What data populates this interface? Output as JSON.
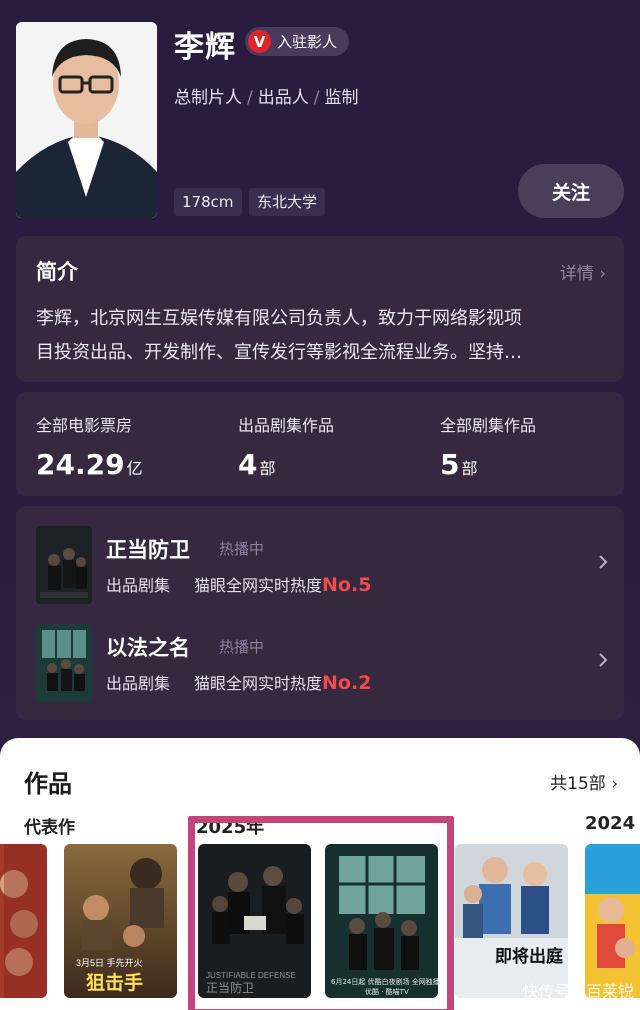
{
  "profile": {
    "name": "李辉",
    "badge": "入驻影人",
    "badge_letter": "V",
    "roles": [
      "总制片人",
      "出品人",
      "监制"
    ],
    "height": "178cm",
    "school": "东北大学",
    "follow_label": "关注"
  },
  "intro": {
    "title": "简介",
    "more": "详情",
    "line1": "李辉，北京网生互娱传媒有限公司负责人，致力于网络影视项",
    "line2": "目投资出品、开发制作、宣传发行等影视全流程业务。坚持…"
  },
  "stats": [
    {
      "label": "全部电影票房",
      "value": "24.29",
      "unit": "亿"
    },
    {
      "label": "出品剧集作品",
      "value": "4",
      "unit": "部"
    },
    {
      "label": "全部剧集作品",
      "value": "5",
      "unit": "部"
    }
  ],
  "shows": [
    {
      "title": "正当防卫",
      "status": "热播中",
      "type": "出品剧集",
      "heat_label": "猫眼全网实时热度",
      "rank": "No.5"
    },
    {
      "title": "以法之名",
      "status": "热播中",
      "type": "出品剧集",
      "heat_label": "猫眼全网实时热度",
      "rank": "No.2"
    }
  ],
  "works": {
    "title": "作品",
    "count": "共15部",
    "representative": "代表作",
    "year_a": "2025年",
    "year_b": "2024",
    "poster1_text": "3月5日 手先开火",
    "poster1_title": "狙击手",
    "poster2_text": "JUSTIFIABLE DEFENSE",
    "poster2_cn": "正当防卫",
    "poster3_text": "6月24日起 优酷白夜剧场 全网独播",
    "poster3_brand": "优酷 · 酷喵TV",
    "poster4_title": "即将出庭",
    "watermark": "快传号 / 百莱锐"
  },
  "colors": {
    "bg": "#2a1c3e",
    "card": "#35283f",
    "accent_red": "#ee4b4b",
    "highlight": "#c3457b"
  }
}
